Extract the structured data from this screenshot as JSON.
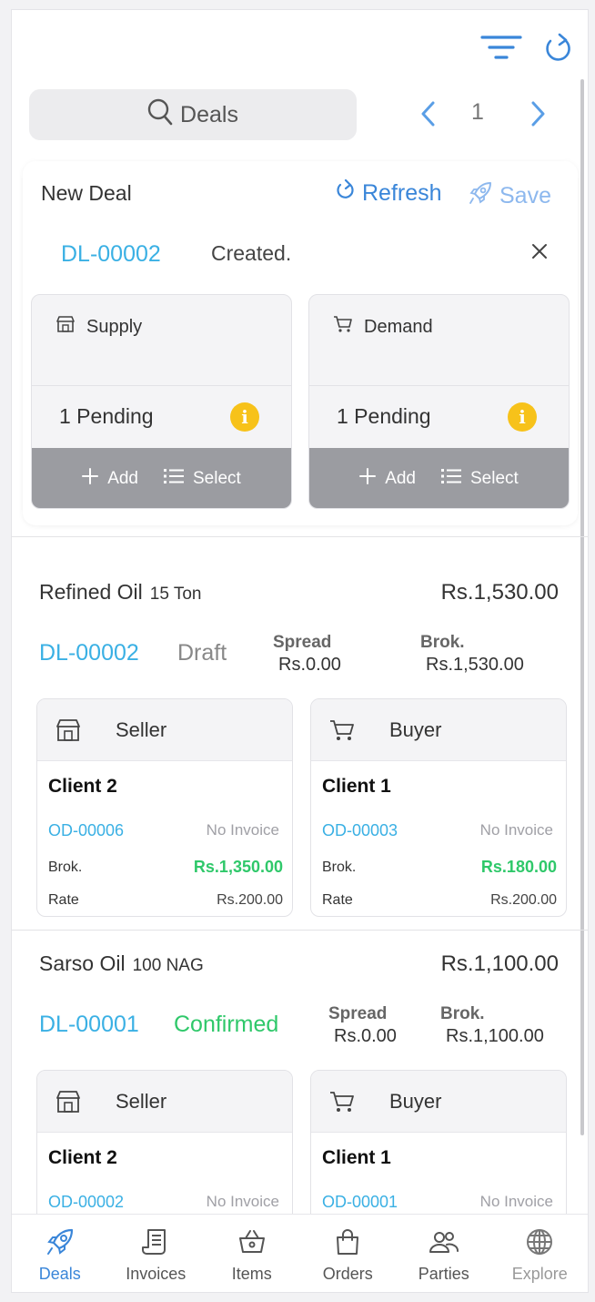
{
  "search": {
    "placeholder": "Deals"
  },
  "pager": {
    "page": "1"
  },
  "new_deal": {
    "title": "New Deal",
    "refresh_label": "Refresh",
    "save_label": "Save",
    "deal_id": "DL-00002",
    "status": "Created.",
    "supply": {
      "label": "Supply",
      "pending": "1 Pending",
      "add_label": "Add",
      "select_label": "Select"
    },
    "demand": {
      "label": "Demand",
      "pending": "1 Pending",
      "add_label": "Add",
      "select_label": "Select"
    }
  },
  "deals": [
    {
      "product": "Refined Oil",
      "quantity": "15 Ton",
      "amount": "Rs.1,530.00",
      "id": "DL-00002",
      "status": "Draft",
      "status_color": "#888888",
      "spread_label": "Spread",
      "spread_value": "Rs.0.00",
      "brok_label": "Brok.",
      "brok_value": "Rs.1,530.00",
      "seller": {
        "role": "Seller",
        "client": "Client 2",
        "order": "OD-00006",
        "invoice": "No Invoice",
        "brok_label": "Brok.",
        "brok_value": "Rs.1,350.00",
        "rate_label": "Rate",
        "rate_value": "Rs.200.00"
      },
      "buyer": {
        "role": "Buyer",
        "client": "Client 1",
        "order": "OD-00003",
        "invoice": "No Invoice",
        "brok_label": "Brok.",
        "brok_value": "Rs.180.00",
        "rate_label": "Rate",
        "rate_value": "Rs.200.00"
      }
    },
    {
      "product": "Sarso Oil",
      "quantity": "100 NAG",
      "amount": "Rs.1,100.00",
      "id": "DL-00001",
      "status": "Confirmed",
      "status_color": "#2fc86a",
      "spread_label": "Spread",
      "spread_value": "Rs.0.00",
      "brok_label": "Brok.",
      "brok_value": "Rs.1,100.00",
      "seller": {
        "role": "Seller",
        "client": "Client 2",
        "order": "OD-00002",
        "invoice": "No Invoice"
      },
      "buyer": {
        "role": "Buyer",
        "client": "Client 1",
        "order": "OD-00001",
        "invoice": "No Invoice"
      }
    }
  ],
  "nav": [
    {
      "label": "Deals",
      "icon": "rocket-icon"
    },
    {
      "label": "Invoices",
      "icon": "receipt-icon"
    },
    {
      "label": "Items",
      "icon": "basket-icon"
    },
    {
      "label": "Orders",
      "icon": "bag-icon"
    },
    {
      "label": "Parties",
      "icon": "people-icon"
    },
    {
      "label": "Explore",
      "icon": "globe-icon"
    }
  ],
  "colors": {
    "accent": "#3a86d9",
    "id_blue": "#3ab0e4",
    "success": "#2fc86a",
    "warning": "#f7c21a"
  }
}
